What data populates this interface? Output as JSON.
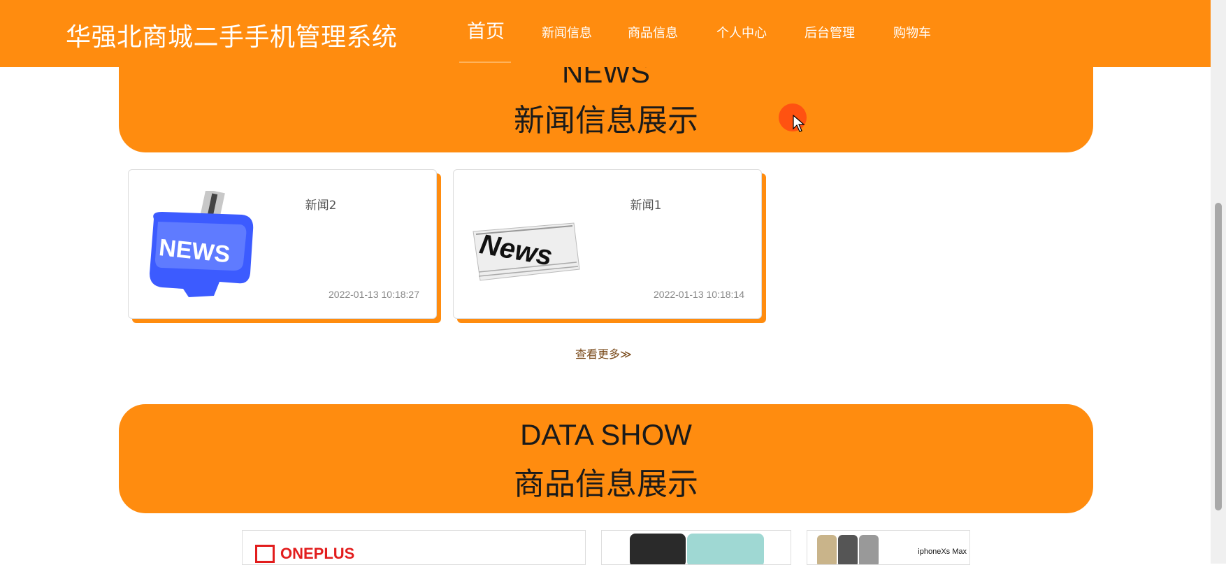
{
  "header": {
    "title": "华强北商城二手手机管理系统",
    "nav": [
      {
        "label": "首页",
        "active": true
      },
      {
        "label": "新闻信息"
      },
      {
        "label": "商品信息"
      },
      {
        "label": "个人中心"
      },
      {
        "label": "后台管理"
      },
      {
        "label": "购物车"
      }
    ]
  },
  "news_section": {
    "title_en": "NEWS",
    "title_cn": "新闻信息展示",
    "items": [
      {
        "title": "新闻2",
        "time": "2022-01-13 10:18:27",
        "image": "news-key-icon"
      },
      {
        "title": "新闻1",
        "time": "2022-01-13 10:18:14",
        "image": "newspaper-icon"
      }
    ],
    "more_label": "查看更多≫"
  },
  "product_section": {
    "title_en": "DATA SHOW",
    "title_cn": "商品信息展示",
    "items": [
      {
        "brand": "ONEPLUS"
      },
      {
        "brand": ""
      },
      {
        "brand": "iphoneXs Max"
      }
    ]
  },
  "colors": {
    "accent": "#ff8c0f",
    "cursor": "#ff4b12"
  }
}
